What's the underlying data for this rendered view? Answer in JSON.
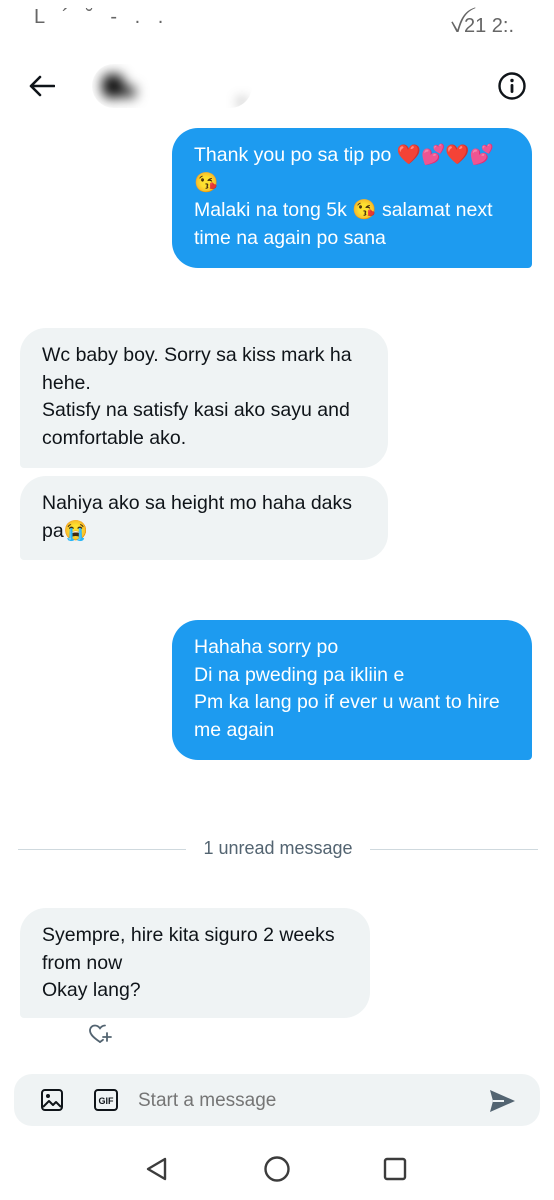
{
  "status_bar": {
    "left": "L ´ ˘ - . .",
    "right": "ꪜ21 2:."
  },
  "header": {
    "back_icon": "arrow-left-icon",
    "info_icon": "info-circle-icon"
  },
  "messages": [
    {
      "direction": "out",
      "lines": [
        "Thank you po sa tip po ❤️💕❤️💕",
        "😘",
        "Malaki na tong 5k 😘 salamat next",
        "time na again po sana"
      ]
    },
    {
      "direction": "in",
      "lines": [
        "Wc baby boy. Sorry sa kiss mark ha",
        "hehe.",
        "Satisfy na satisfy kasi ako sayu and",
        "comfortable ako."
      ]
    },
    {
      "direction": "in",
      "lines": [
        "Nahiya ako sa height mo haha daks",
        "pa😭"
      ]
    },
    {
      "direction": "out",
      "lines": [
        "Hahaha sorry po",
        "Di na pweding pa ikliin e",
        "Pm ka lang po if ever u want to hire",
        "me again"
      ]
    },
    {
      "direction": "in",
      "lines": [
        "Syempre, hire kita siguro 2 weeks",
        "from now",
        "Okay lang?"
      ]
    }
  ],
  "divider": {
    "label": "1 unread message"
  },
  "composer": {
    "placeholder": "Start a message",
    "gif_label": "GIF"
  },
  "colors": {
    "outgoing_bubble": "#1d9bf0",
    "incoming_bubble": "#eff3f4",
    "accent": "#1d9bf0"
  }
}
